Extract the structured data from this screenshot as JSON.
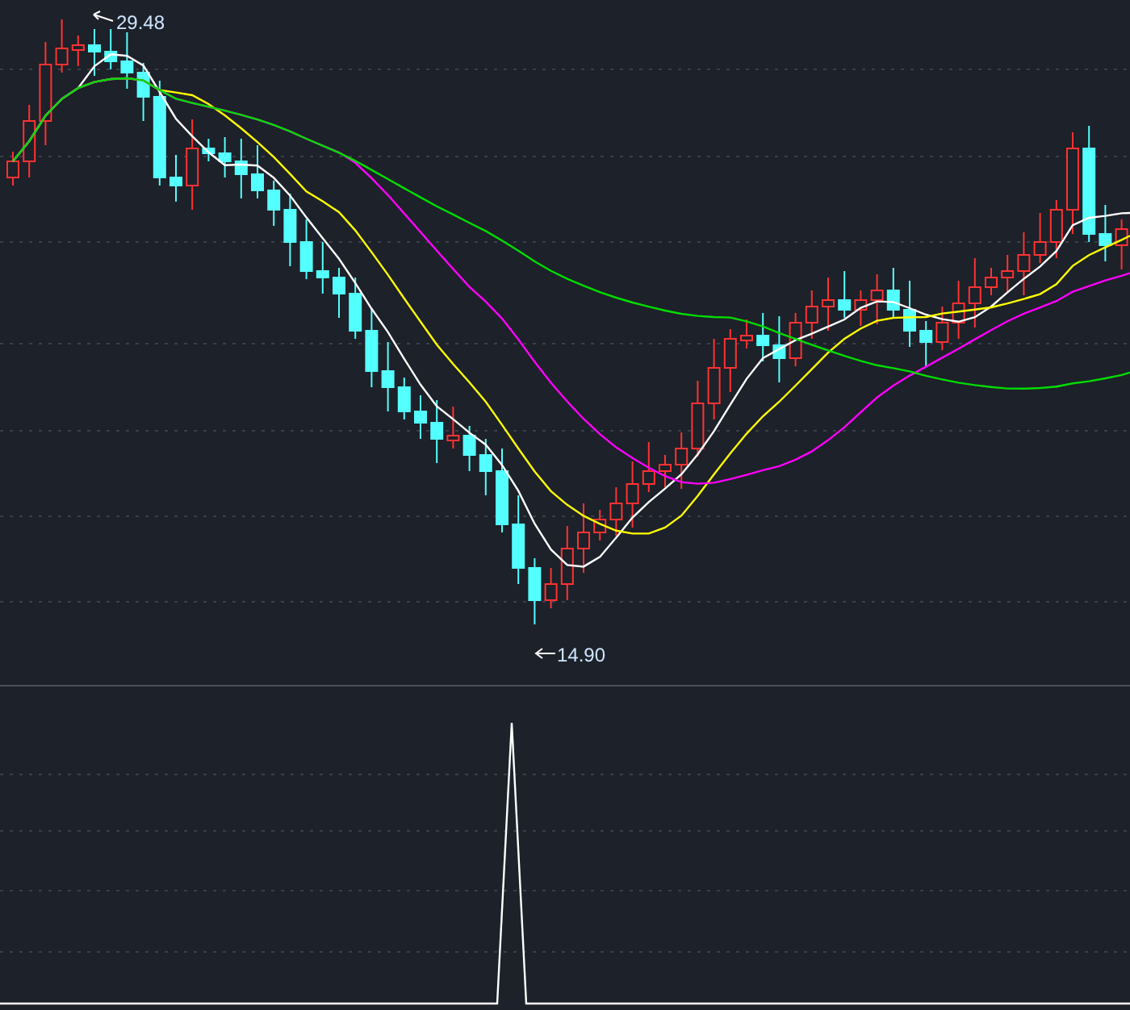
{
  "price_chart": {
    "high_label": "29.48",
    "low_label": "14.90"
  }
}
